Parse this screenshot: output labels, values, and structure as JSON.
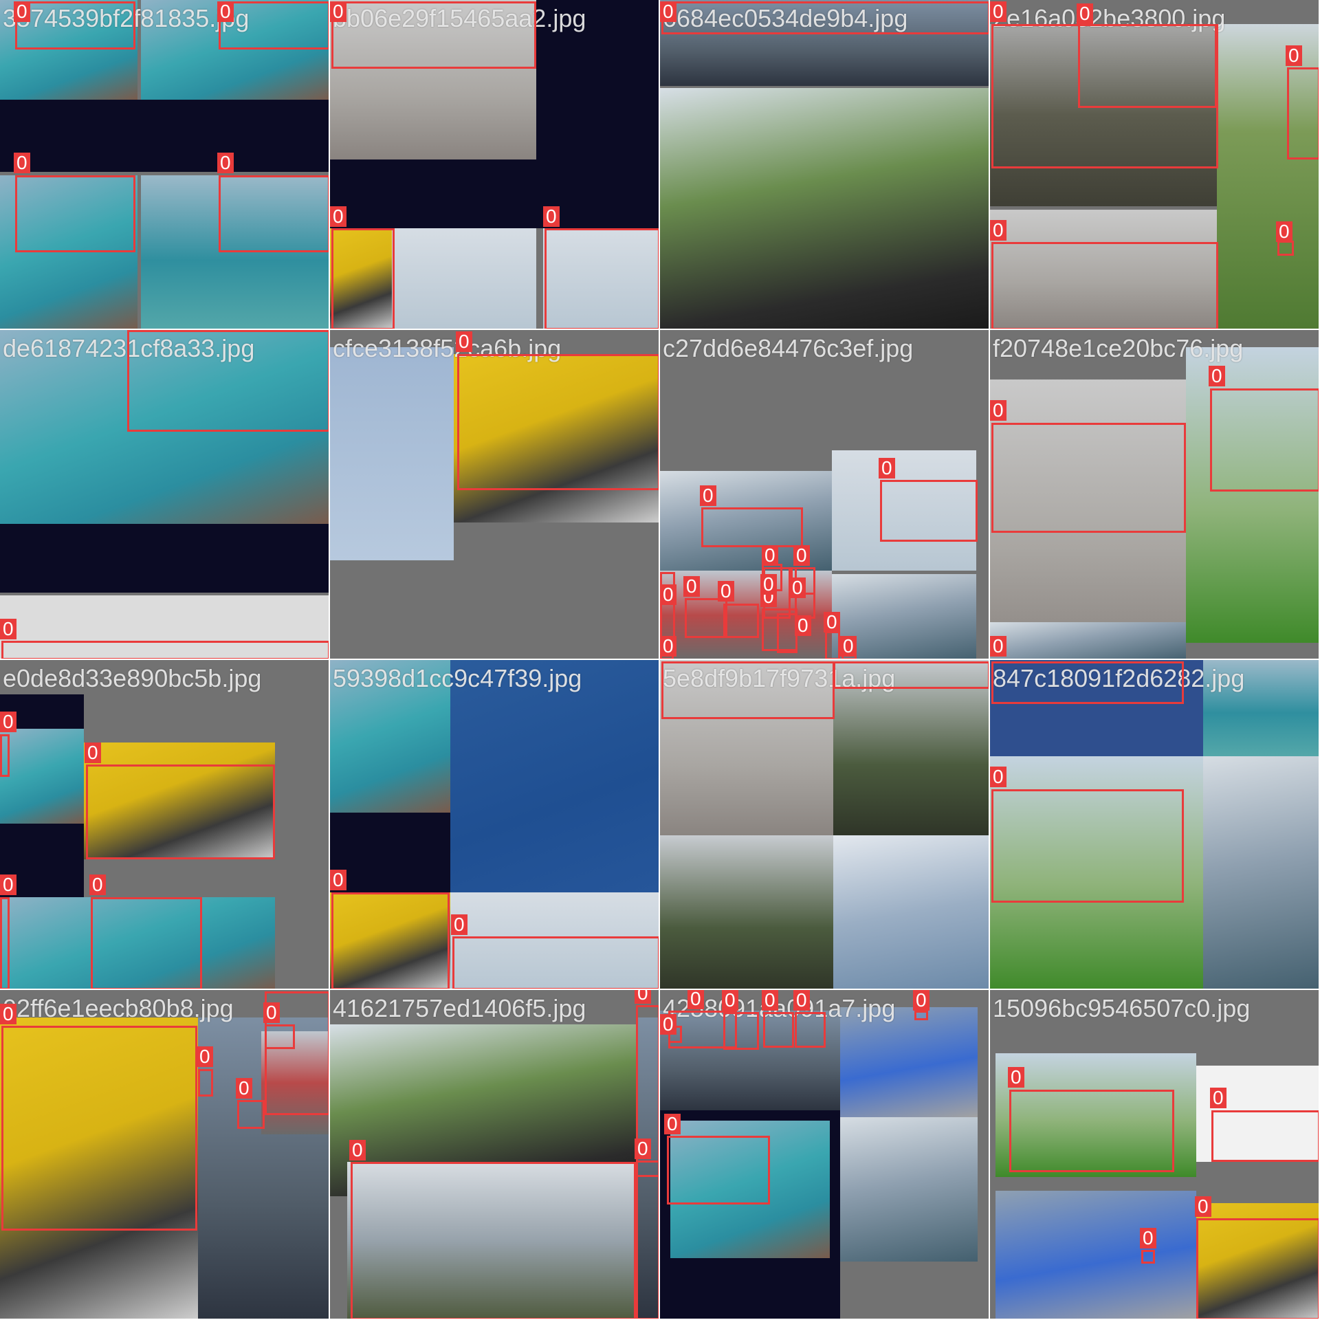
{
  "label_color": "#e93b3b",
  "box_label": "0",
  "tiles": [
    {
      "filename": "3574539bf2f81835.jpg"
    },
    {
      "filename": "bb06e29f15465aa2.jpg"
    },
    {
      "filename": "6684ec0534de9b4.jpg"
    },
    {
      "filename": "2e16a032be3800.jpg"
    },
    {
      "filename": "de61874231cf8a33.jpg"
    },
    {
      "filename": "cfce3138f52ca6b.jpg"
    },
    {
      "filename": "c27dd6e84476c3ef.jpg"
    },
    {
      "filename": "f20748e1ce20bc76.jpg"
    },
    {
      "filename": "e0de8d33e890bc5b.jpg"
    },
    {
      "filename": "59398d1cc9c47f39.jpg"
    },
    {
      "filename": "5e8df9b17f9731a.jpg"
    },
    {
      "filename": "847c18091f2d6282.jpg"
    },
    {
      "filename": "02ff6e1eecb80b8.jpg"
    },
    {
      "filename": "41621757ed1406f5.jpg"
    },
    {
      "filename": "4258091aa091a7.jpg"
    },
    {
      "filename": "15096bc9546507c0.jpg"
    }
  ]
}
